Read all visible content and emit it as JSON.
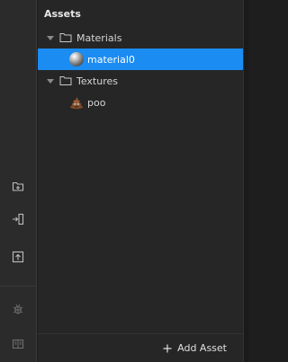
{
  "panel": {
    "title": "Assets"
  },
  "tree": {
    "materials_folder": "Materials",
    "material0": "material0",
    "textures_folder": "Textures",
    "poo": "poo"
  },
  "footer": {
    "add_asset_label": "Add Asset"
  },
  "colors": {
    "selection": "#1b8cf2",
    "panel_bg": "#262626",
    "toolbar_bg": "#2b2b2b"
  }
}
